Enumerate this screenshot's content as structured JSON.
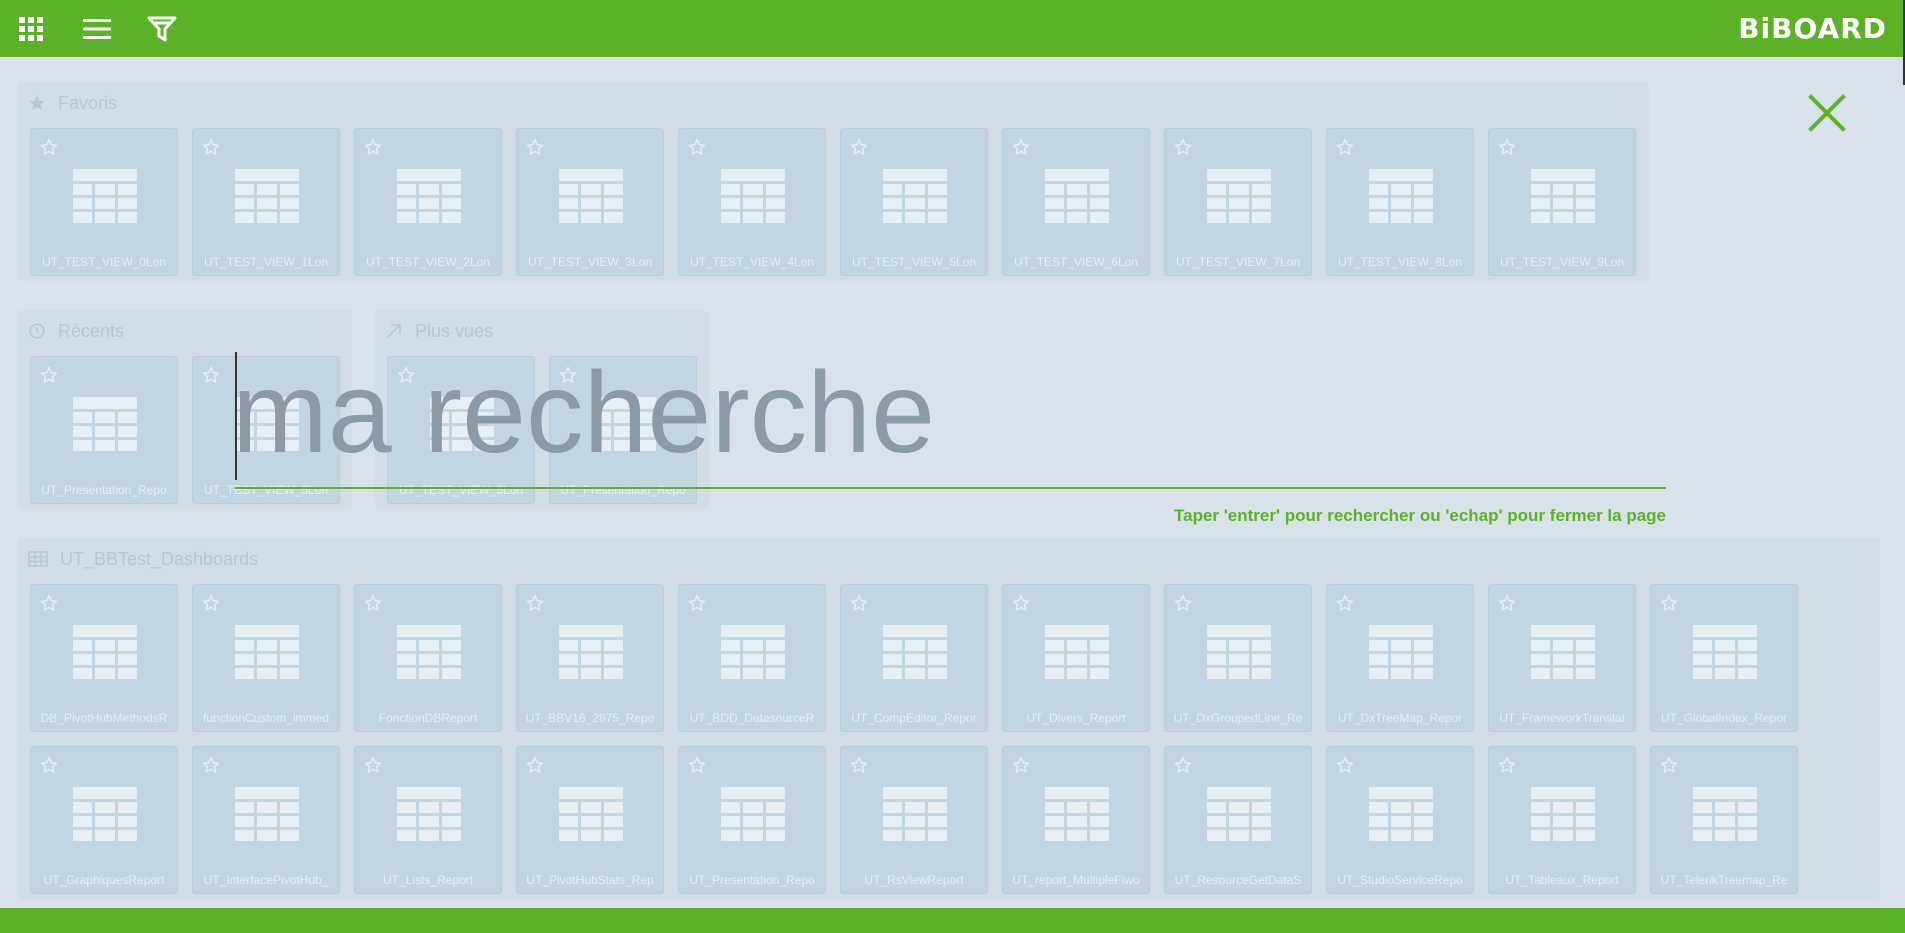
{
  "header": {
    "logo_text": "BiBOARD",
    "icons": [
      "apps-grid-icon",
      "hamburger-menu-icon",
      "filter-icon"
    ]
  },
  "colors": {
    "brand": "#5cb226",
    "background": "#d9e2ea",
    "tile": "#c3d5e1",
    "search_text": "#8c9aa6"
  },
  "sections": {
    "favoris": {
      "title": "Favoris",
      "tiles": [
        "UT_TEST_VIEW_0Lon",
        "UT_TEST_VIEW_1Lon",
        "UT_TEST_VIEW_2Lon",
        "UT_TEST_VIEW_3Lon",
        "UT_TEST_VIEW_4Lon",
        "UT_TEST_VIEW_5Lon",
        "UT_TEST_VIEW_6Lon",
        "UT_TEST_VIEW_7Lon",
        "UT_TEST_VIEW_8Lon",
        "UT_TEST_VIEW_9Lon"
      ]
    },
    "recents": {
      "title": "Récents",
      "tiles": [
        "UT_Presentation_Repo",
        "UT_TEST_VIEW_5Lon"
      ]
    },
    "plus_vues": {
      "title": "Plus vues",
      "tiles": [
        "UT_TEST_VIEW_5Lon",
        "UT_Presentation_Repo"
      ]
    },
    "dashboards": {
      "title": "UT_BBTest_Dashboards",
      "row1": [
        "DB_PivotHubMethodsR",
        "functionCustom_immed",
        "FonctionDBReport",
        "UT_BBV16_2875_Repo",
        "UT_BDD_DatasourceR",
        "UT_CompEditor_Repor",
        "UT_Divers_Report",
        "UT_DxGroupedLine_Re",
        "UT_DxTreeMap_Repor",
        "UT_FrameworkTranslat",
        "UT_GlobalIndex_Repor"
      ],
      "row2": [
        "UT_GraphiquesReport",
        "UT_InterfacePivotHub_",
        "UT_Lists_Report",
        "UT_PivotHubStats_Rep",
        "UT_Presentation_Repo",
        "UT_RsViewReport",
        "UT_report_MultipleFiwo",
        "UT_ResourceGetDataS",
        "UT_StudioServiceRepo",
        "UT_Tableaux_Report",
        "UT_TelerikTreemap_Re"
      ]
    }
  },
  "search": {
    "value": "ma recherche",
    "hint": "Taper 'entrer' pour rechercher ou 'echap' pour fermer la page",
    "close_icon": "close-icon"
  }
}
